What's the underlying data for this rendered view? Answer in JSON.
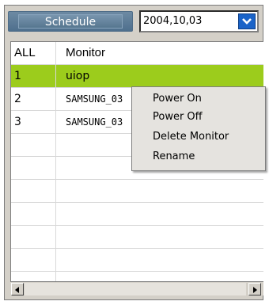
{
  "toolbar": {
    "schedule_label": "Schedule",
    "date_value": "2004,10,03"
  },
  "grid": {
    "headers": [
      "ALL",
      "Monitor"
    ],
    "rows": [
      {
        "index": "1",
        "name": "uiop"
      },
      {
        "index": "2",
        "name": "SAMSUNG_03"
      },
      {
        "index": "3",
        "name": "SAMSUNG_03"
      }
    ]
  },
  "context_menu": {
    "items": [
      "Power On",
      "Power Off",
      "Delete Monitor",
      "Rename"
    ]
  },
  "colors": {
    "selected_row": "#9ccc1c",
    "schedule_button": "#5b7b97"
  },
  "icons": {
    "dropdown": "chevron-down-icon",
    "scroll_left": "arrow-left-icon",
    "scroll_right": "arrow-right-icon"
  }
}
